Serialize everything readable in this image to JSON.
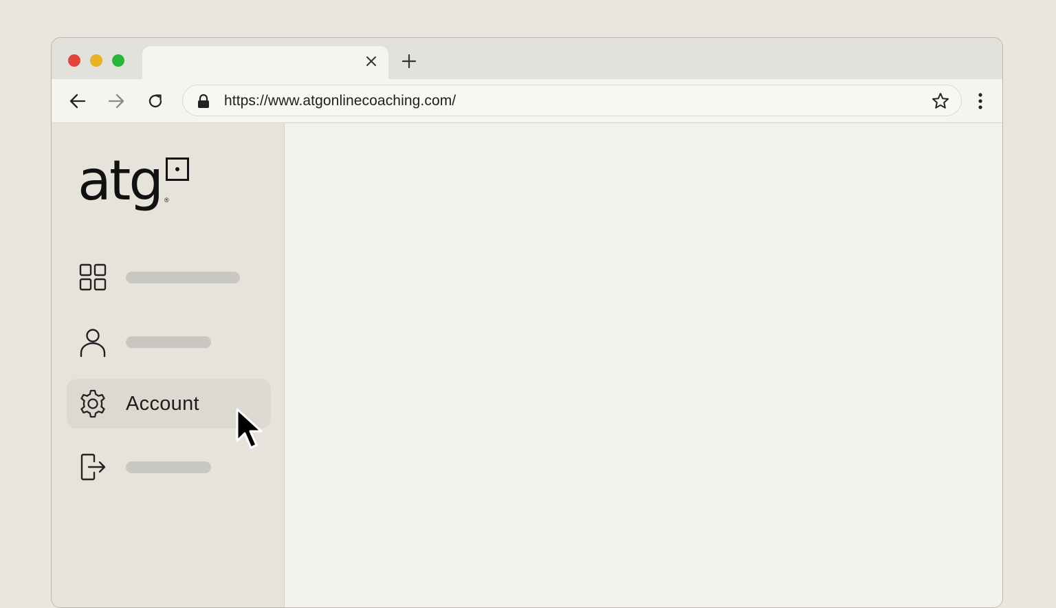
{
  "browser": {
    "tab": {
      "close_icon": "close-icon",
      "new_tab_icon": "plus-icon"
    },
    "toolbar": {
      "back_icon": "arrow-left-icon",
      "forward_icon": "arrow-right-icon",
      "reload_icon": "reload-icon",
      "url": "https://www.atgonlinecoaching.com/",
      "lock_icon": "lock-icon",
      "bookmark_icon": "star-icon",
      "menu_icon": "kebab-menu-icon"
    }
  },
  "sidebar": {
    "logo": {
      "text": "atg",
      "registered": "®"
    },
    "items": [
      {
        "icon": "grid-icon",
        "label": ""
      },
      {
        "icon": "user-icon",
        "label": ""
      },
      {
        "icon": "gear-icon",
        "label": "Account",
        "active": true
      },
      {
        "icon": "logout-icon",
        "label": ""
      }
    ]
  },
  "colors": {
    "background": "#e9e6de",
    "sidebar": "#e6e3db",
    "active_item": "#dcd9d1",
    "placeholder": "#c9c7c2"
  }
}
